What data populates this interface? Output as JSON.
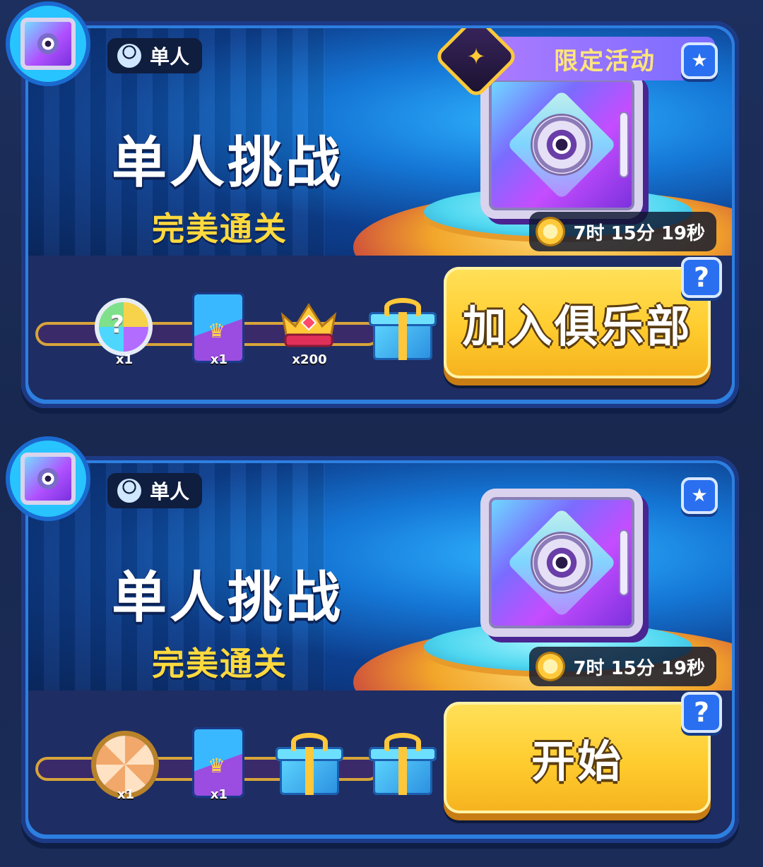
{
  "cards": [
    {
      "mode_label": "单人",
      "title": "单人挑战",
      "subtitle": "完美通关",
      "event_tag": "限定活动",
      "timer": "7时 15分 19秒",
      "rewards": [
        {
          "icon": "sticker-icon",
          "qty": "x1"
        },
        {
          "icon": "card-icon",
          "qty": "x1"
        },
        {
          "icon": "crown-icon",
          "qty": "x200"
        },
        {
          "icon": "gift-icon",
          "qty": ""
        }
      ],
      "action_label": "加入俱乐部",
      "help_label": "?"
    },
    {
      "mode_label": "单人",
      "title": "单人挑战",
      "subtitle": "完美通关",
      "timer": "7时 15分 19秒",
      "rewards": [
        {
          "icon": "wheel-icon",
          "qty": "x1"
        },
        {
          "icon": "card-icon",
          "qty": "x1"
        },
        {
          "icon": "gift-icon",
          "qty": ""
        },
        {
          "icon": "gift-icon",
          "qty": ""
        }
      ],
      "action_label": "开始",
      "help_label": "?"
    }
  ],
  "colors": {
    "card_border": "#2d7fe0",
    "title": "#ffffff",
    "subtitle": "#ffd93d",
    "button": "#ffcc2e",
    "event_tag": "#9a74ff"
  }
}
